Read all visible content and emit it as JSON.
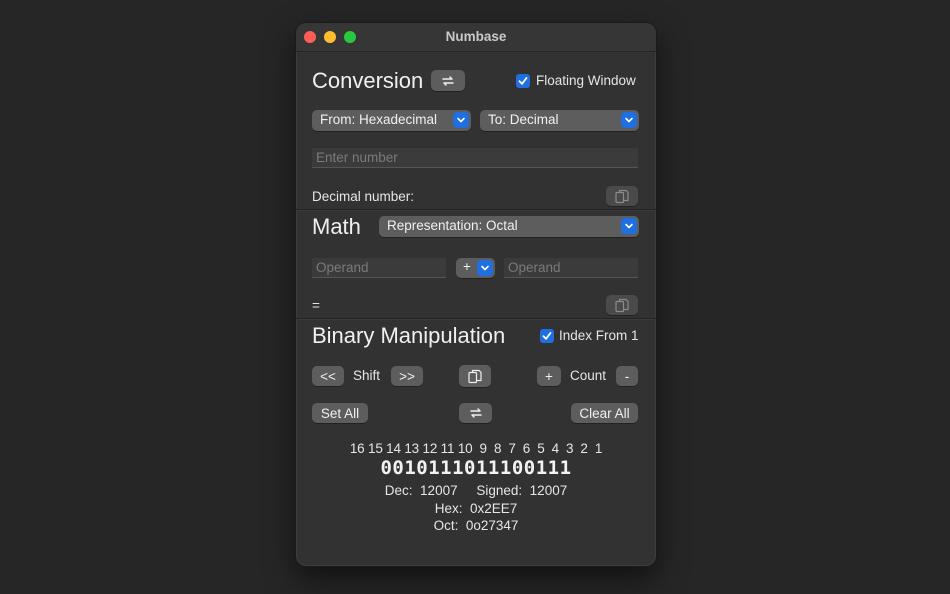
{
  "window": {
    "title": "Numbase"
  },
  "conversion": {
    "heading": "Conversion",
    "floating_label": "Floating Window",
    "from_label": "From: Hexadecimal",
    "to_label": "To: Decimal",
    "input_placeholder": "Enter number",
    "result_label": "Decimal number:"
  },
  "math": {
    "heading": "Math",
    "representation_label": "Representation: Octal",
    "operand1_placeholder": "Operand",
    "operator": "+",
    "operand2_placeholder": "Operand",
    "equals": "="
  },
  "binary": {
    "heading": "Binary Manipulation",
    "index_label": "Index From 1",
    "shift_left": "<<",
    "shift_label": "Shift",
    "shift_right": ">>",
    "plus": "+",
    "count_label": "Count",
    "minus": "-",
    "set_all": "Set All",
    "clear_all": "Clear All",
    "indices": "16 15 14 13 12 11 10  9  8  7  6  5  4  3  2  1",
    "bits": "0010111011100111",
    "dec_label": "Dec:",
    "dec_value": "12007",
    "signed_label": "Signed:",
    "signed_value": "12007",
    "hex_label": "Hex:",
    "hex_value": "0x2EE7",
    "oct_label": "Oct:",
    "oct_value": "0o27347"
  },
  "colors": {
    "accent": "#1f6fe0",
    "window_bg": "#323232",
    "button": "#5d5d5d"
  }
}
